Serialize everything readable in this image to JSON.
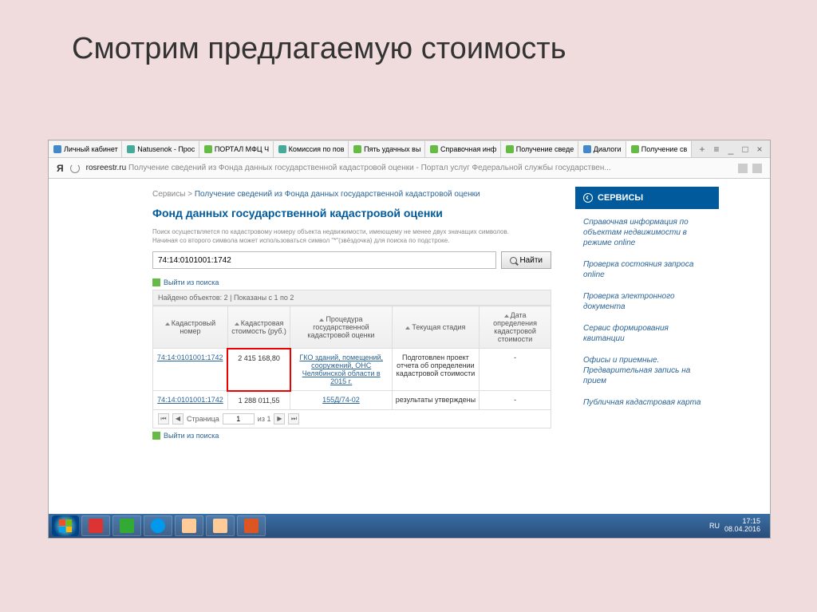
{
  "slide": {
    "title": "Смотрим предлагаемую стоимость"
  },
  "tabs": [
    {
      "label": "Личный кабинет"
    },
    {
      "label": "Natusenok - Прос"
    },
    {
      "label": "ПОРТАЛ МФЦ Ч"
    },
    {
      "label": "Комиссия по пов"
    },
    {
      "label": "Пять удачных вы"
    },
    {
      "label": "Справочная инф"
    },
    {
      "label": "Получение сведе"
    },
    {
      "label": "Диалоги"
    },
    {
      "label": "Получение св"
    }
  ],
  "addr": {
    "logo": "Я",
    "domain": "rosreestr.ru",
    "path": "Получение сведений из Фонда данных государственной кадастровой оценки - Портал услуг Федеральной службы государствен..."
  },
  "breadcrumb": {
    "root": "Сервисы",
    "sep": ">",
    "current": "Получение сведений из Фонда данных государственной кадастровой оценки"
  },
  "page": {
    "h1": "Фонд данных государственной кадастровой оценки",
    "hint1": "Поиск осуществляется по кадастровому номеру объекта недвижимости, имеющему не менее двух значащих символов.",
    "hint2": "Начиная со второго символа может использоваться символ \"*\"(звёздочка) для поиска по подстроке.",
    "search_value": "74:14:0101001:1742",
    "search_btn": "Найти",
    "exit_link": "Выйти из поиска",
    "found_text": "Найдено объектов: 2 | Показаны с 1 по 2"
  },
  "table": {
    "headers": {
      "c1": "Кадастровый номер",
      "c2": "Кадастровая стоимость (руб.)",
      "c3": "Процедура государственной кадастровой оценки",
      "c4": "Текущая стадия",
      "c5": "Дата определения кадастровой стоимости"
    },
    "rows": [
      {
        "num": "74:14:0101001:1742",
        "cost": "2 415 168,80",
        "proc": "ГКО зданий, помещений, сооружений, ОНС Челябинской области в 2015 г.",
        "stage": "Подготовлен проект отчета об определении кадастровой стоимости",
        "date": "-"
      },
      {
        "num": "74:14:0101001:1742",
        "cost": "1 288 011,55",
        "proc": "155Д/74-02",
        "stage": "результаты утверждены",
        "date": "-"
      }
    ]
  },
  "pager": {
    "label_page": "Страница",
    "current": "1",
    "of": "из 1"
  },
  "sidebar": {
    "header": "СЕРВИСЫ",
    "links": [
      "Справочная информация по объектам недвижимости в режиме online",
      "Проверка состояния запроса online",
      "Проверка электронного документа",
      "Сервис формирования квитанции",
      "Офисы и приемные. Предварительная запись на прием",
      "Публичная кадастровая карта"
    ]
  },
  "tray": {
    "lang": "RU",
    "time": "17:15",
    "date": "08.04.2016"
  }
}
